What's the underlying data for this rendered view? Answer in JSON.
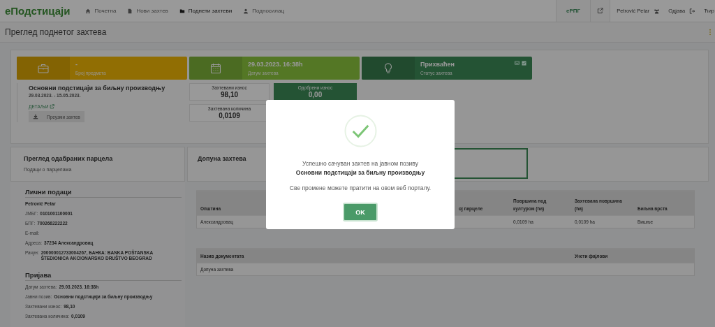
{
  "navbar": {
    "logo": "еПодстицаји",
    "items": [
      {
        "label": "Почетна",
        "selected": false
      },
      {
        "label": "Нови захтев",
        "selected": false
      },
      {
        "label": "Поднети захтеви",
        "selected": true
      },
      {
        "label": "Подносилац",
        "selected": false
      }
    ],
    "erpg_button": "еРПГ",
    "user_name": "Petrović Petar",
    "logout": "Одјава",
    "language": "Ћир"
  },
  "page_title": "Преглед поднетог захтева",
  "tiles": [
    {
      "value": "-",
      "label": "Број предмета",
      "kind": "number",
      "status_icons": false
    },
    {
      "value": "29.03.2023. 16:38h",
      "label": "Датум захтева",
      "kind": "date",
      "status_icons": false
    },
    {
      "value": "Прихваћен",
      "label": "Статус захтева",
      "kind": "status",
      "status_icons": true
    }
  ],
  "application": {
    "title": "Основни подстицаји за биљну производњу",
    "dates": "29.03.2023. - 15.05.2023.",
    "details_link": "ДЕТАЉИ",
    "download_button": "Преузми захтев"
  },
  "amounts": [
    {
      "label": "Захтевани износ",
      "value": "98,10",
      "kind": "plain"
    },
    {
      "label": "Одобрени износ",
      "value": "0,00",
      "kind": "approved"
    },
    {
      "label": "Захтевана количина",
      "value": "0,0109",
      "kind": "plain"
    }
  ],
  "parcels_card": {
    "title": "Преглед одабраних парцела",
    "subtitle": "Подаци о парцелама"
  },
  "supplement_card": {
    "title": "Допуна захтева"
  },
  "personal": {
    "heading": "Лични подаци",
    "name": "Petrović Petar",
    "fields": [
      {
        "label": "ЈМБГ:",
        "value": "0101001100001"
      },
      {
        "label": "БПГ:",
        "value": "700266222222"
      },
      {
        "label": "E-mail:"
      },
      {
        "label": "Адреса:",
        "value": "37234 Александровац"
      },
      {
        "label": "Рачун:",
        "value": "200000012733004267, БАНКА: BANKA POŠTANSKA ŠTEDIONICA AKCIONARSKO DRUŠTVO BEOGRAD"
      }
    ]
  },
  "application_info": {
    "heading": "Пријава",
    "fields": [
      {
        "label": "Датум захтева:",
        "value": "29.03.2023. 16:38h"
      },
      {
        "label": "Јавни позив:",
        "value": "Основни подстицаји за биљну производњу"
      },
      {
        "label": "Захтевани износ:",
        "value": "98,10"
      },
      {
        "label": "Захтевана количина:",
        "value": "0,0109"
      }
    ]
  },
  "parcel_table": {
    "columns": [
      "Општина",
      "ој парцеле",
      "Површина под културом (ha)",
      "Захтевана површина (ha)",
      "Биљна врста"
    ],
    "rows": [
      {
        "cells": [
          "Александровац",
          null,
          "0,0109 ha",
          "0,0109 ha",
          "Вишње"
        ]
      }
    ]
  },
  "documents_table": {
    "columns": [
      "Назив документата",
      "Унети фајлови"
    ],
    "rows": [
      {
        "cells": [
          "Допуна захтева",
          null
        ]
      }
    ]
  },
  "modal": {
    "message": "Успешно сачуван захтев на јавном позиву",
    "title": "Основни подстицаји за биљну производњу",
    "note": "Све промене можете пратити на овом веб порталу.",
    "ok_button": "OK"
  }
}
